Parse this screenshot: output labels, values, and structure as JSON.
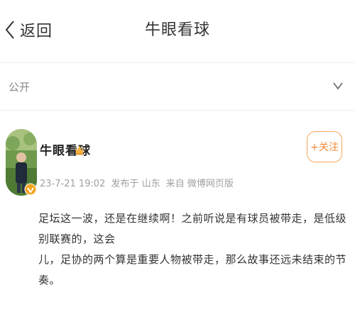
{
  "nav": {
    "back_label": "返回",
    "title": "牛眼看球"
  },
  "visibility": {
    "label": "公开"
  },
  "post": {
    "author": "牛眼看球",
    "date": "23-7-21 19:02",
    "location": "发布于 山东",
    "source": "来自 微博网页版",
    "follow_label": "+关注",
    "text_line1": "足坛这一波，还是在继续啊！之前听说是有球员被带走，是低级别联赛的，这会",
    "text_line2": "儿，足协的两个算是重要人物被带走，那么故事还远未结束的节奏。"
  },
  "colors": {
    "accent": "#f0883a",
    "verified": "#f5a623",
    "muted": "#a0a0a0"
  }
}
